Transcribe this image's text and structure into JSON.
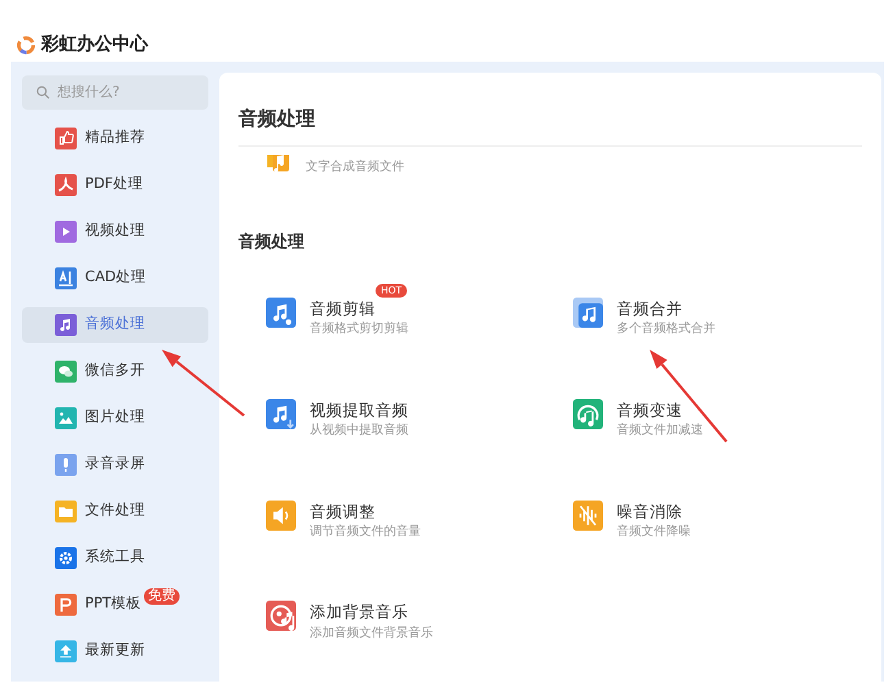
{
  "app": {
    "title": "彩虹办公中心"
  },
  "search": {
    "placeholder": "想搜什么?"
  },
  "sidebar": {
    "items": [
      {
        "label": "精品推荐",
        "selected": false
      },
      {
        "label": "PDF处理",
        "selected": false
      },
      {
        "label": "视频处理",
        "selected": false
      },
      {
        "label": "CAD处理",
        "selected": false
      },
      {
        "label": "音频处理",
        "selected": true
      },
      {
        "label": "微信多开",
        "selected": false
      },
      {
        "label": "图片处理",
        "selected": false
      },
      {
        "label": "录音录屏",
        "selected": false
      },
      {
        "label": "文件处理",
        "selected": false
      },
      {
        "label": "系统工具",
        "selected": false
      },
      {
        "label": "PPT模板",
        "selected": false,
        "badge": "免费"
      },
      {
        "label": "最新更新",
        "selected": false
      }
    ]
  },
  "main": {
    "title": "音频处理",
    "partial_item": {
      "subtitle": "文字合成音频文件"
    },
    "section_title": "音频处理",
    "tools": [
      {
        "title": "音频剪辑",
        "subtitle": "音频格式剪切剪辑",
        "badge": "HOT"
      },
      {
        "title": "音频合并",
        "subtitle": "多个音频格式合并"
      },
      {
        "title": "视频提取音频",
        "subtitle": "从视频中提取音频"
      },
      {
        "title": "音频变速",
        "subtitle": "音频文件加减速"
      },
      {
        "title": "音频调整",
        "subtitle": "调节音频文件的音量"
      },
      {
        "title": "噪音消除",
        "subtitle": "音频文件降噪"
      },
      {
        "title": "添加背景音乐",
        "subtitle": "添加音频文件背景音乐"
      }
    ]
  },
  "annotations": [
    {
      "kind": "arrow"
    },
    {
      "kind": "arrow"
    }
  ]
}
